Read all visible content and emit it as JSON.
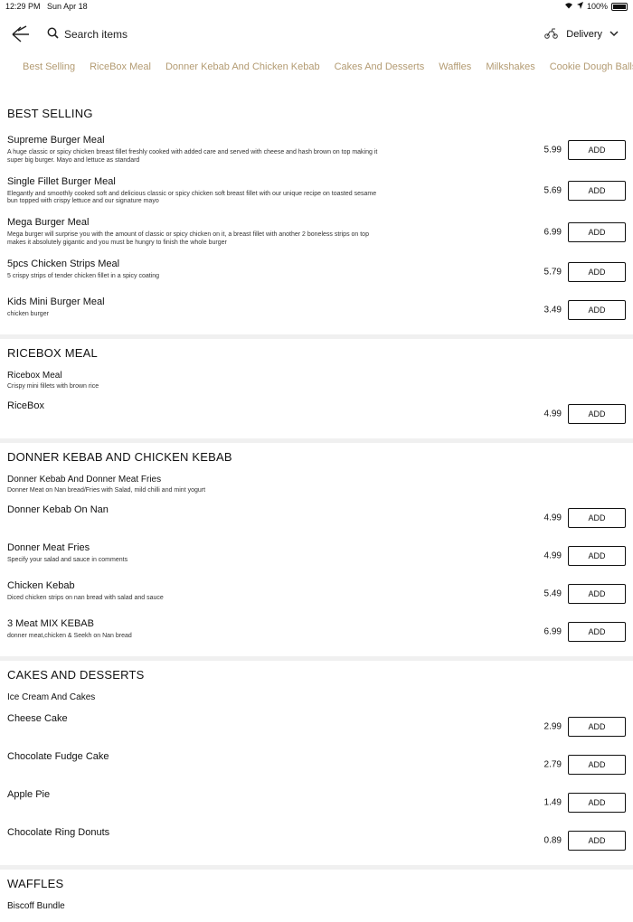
{
  "status": {
    "time": "12:29 PM",
    "date": "Sun Apr 18",
    "battery": "100%"
  },
  "header": {
    "search_placeholder": "Search items",
    "delivery_label": "Delivery"
  },
  "categories": [
    "Best Selling",
    "RiceBox Meal",
    "Donner Kebab And Chicken Kebab",
    "Cakes And Desserts",
    "Waffles",
    "Milkshakes",
    "Cookie Dough Balls"
  ],
  "add_label": "ADD",
  "sections": [
    {
      "title": "BEST SELLING",
      "items": [
        {
          "name": "Supreme Burger Meal",
          "desc": "A huge classic or spicy chicken breast fillet freshly cooked with added care and served with cheese and hash brown on top making it super big burger. Mayo and lettuce as standard",
          "price": "5.99"
        },
        {
          "name": "Single Fillet Burger Meal",
          "desc": "Elegantly and smoothly cooked soft and delicious classic or spicy chicken soft breast fillet with our unique recipe on toasted sesame bun topped with crispy lettuce and our signature mayo",
          "price": "5.69"
        },
        {
          "name": "Mega Burger Meal",
          "desc": "Mega burger will surprise you with the amount of classic or spicy chicken on it, a breast fillet with another 2 boneless strips on top makes it absolutely gigantic and you must be hungry to finish the whole burger",
          "price": "6.99"
        },
        {
          "name": "5pcs Chicken Strips Meal",
          "desc": "5 crispy strips of tender chicken fillet in a spicy coating",
          "price": "5.79"
        },
        {
          "name": "Kids Mini Burger Meal",
          "desc": "chicken burger",
          "price": "3.49"
        }
      ]
    },
    {
      "title": "RICEBOX MEAL",
      "sub": {
        "name": "Ricebox Meal",
        "desc": "Crispy mini fillets with brown rice"
      },
      "items": [
        {
          "name": "RiceBox",
          "desc": "",
          "price": "4.99"
        }
      ]
    },
    {
      "title": "DONNER KEBAB AND CHICKEN KEBAB",
      "sub": {
        "name": "Donner Kebab And Donner Meat Fries",
        "desc": "Donner Meat on Nan bread/Fries with Salad, mild chilli and mint yogurt"
      },
      "items": [
        {
          "name": "Donner Kebab On Nan",
          "desc": "",
          "price": "4.99"
        },
        {
          "name": "Donner Meat Fries",
          "desc": "Specify your salad and sauce in comments",
          "price": "4.99"
        },
        {
          "name": "Chicken Kebab",
          "desc": "Diced chicken strips on nan bread with salad and sauce",
          "price": "5.49"
        },
        {
          "name": "3 Meat MIX KEBAB",
          "desc": "donner meat,chicken & Seekh on Nan bread",
          "price": "6.99"
        }
      ]
    },
    {
      "title": "CAKES AND DESSERTS",
      "sub": {
        "name": "Ice Cream And Cakes",
        "desc": ""
      },
      "items": [
        {
          "name": "Cheese Cake",
          "desc": "",
          "price": "2.99"
        },
        {
          "name": "Chocolate Fudge Cake",
          "desc": "",
          "price": "2.79"
        },
        {
          "name": "Apple Pie",
          "desc": "",
          "price": "1.49"
        },
        {
          "name": "Chocolate Ring Donuts",
          "desc": "",
          "price": "0.89"
        }
      ]
    },
    {
      "title": "WAFFLES",
      "sub": {
        "name": "Biscoff Bundle",
        "desc": ""
      },
      "items": []
    }
  ]
}
